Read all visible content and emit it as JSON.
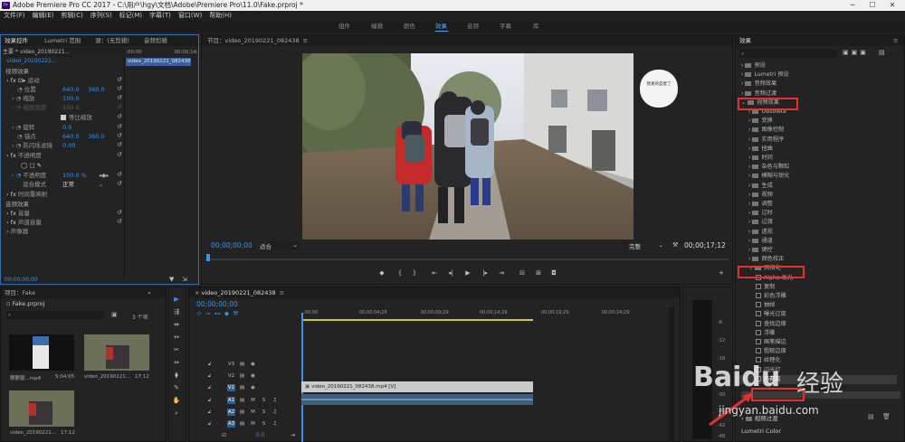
{
  "window": {
    "title": "Adobe Premiere Pro CC 2017 - C:\\用户\\hgy\\文档\\Adobe\\Premiere Pro\\11.0\\Fake.prproj *",
    "app_icon": "Pr",
    "minimize": "─",
    "maximize": "☐",
    "close": "✕"
  },
  "menu": [
    "文件(F)",
    "编辑(E)",
    "剪辑(C)",
    "序列(S)",
    "标记(M)",
    "字幕(T)",
    "窗口(W)",
    "帮助(H)"
  ],
  "workspace_tabs": [
    "组件",
    "编辑",
    "颜色",
    "效果",
    "音频",
    "字幕",
    "库"
  ],
  "workspace_active": "效果",
  "effect_controls": {
    "tabs": [
      "效果控件",
      "Lumetri 范围",
      "源：(无剪辑)",
      "音频剪辑"
    ],
    "master": "主要 * video_20190221...",
    "clip": "video_20190221...",
    "ruler_start": ":00:00",
    "ruler_end": "00:00;14;",
    "clip_bar": "video_20190221_082438.m",
    "video_effects": "视频效果",
    "motion": "运动",
    "position_label": "位置",
    "position_x": "640.0",
    "position_y": "360.0",
    "scale_label": "缩放",
    "scale_val": "100.0",
    "scale_width_label": "缩放宽度",
    "scale_width_val": "100.0",
    "uniform_scale": "等比缩放",
    "rotation_label": "旋转",
    "rotation_val": "0.0",
    "anchor_label": "锚点",
    "anchor_x": "640.0",
    "anchor_y": "360.0",
    "flicker_label": "防闪烁滤镜",
    "flicker_val": "0.00",
    "opacity": "不透明度",
    "opacity_label": "不透明度",
    "opacity_val": "100.0 %",
    "blend_label": "混合模式",
    "blend_val": "正常",
    "time_remap": "时间重映射",
    "audio_effects": "音频效果",
    "volume": "音量",
    "channel_volume": "声道音量",
    "panner": "声像器",
    "timecode": "00;00;00;00"
  },
  "program": {
    "title": "节目：video_20190221_082438",
    "timecode": "00;00;00;00",
    "fit": "适合",
    "quality": "完整",
    "duration": "00;00;17;12",
    "sticker": "我真的是傻了"
  },
  "project": {
    "title": "项目：Fake",
    "file": "Fake.prproj",
    "count": "3 个项",
    "items": [
      {
        "name": "颤颤锯...mp4",
        "dur": "5;04;05"
      },
      {
        "name": "video_20190221...",
        "dur": "17;12"
      },
      {
        "name": "video_20190221...",
        "dur": "17;12"
      }
    ]
  },
  "timeline": {
    "title": "video_20190221_082438",
    "timecode": "00;00;00;00",
    "ruler": [
      ";00;00",
      "00;00;04;29",
      "00;00;09;29",
      "00;00;14;29",
      "00;00;19;29",
      "00;00;24;29"
    ],
    "video_tracks": [
      "V3",
      "V2",
      "V1"
    ],
    "audio_tracks": [
      "A1",
      "A2",
      "A3"
    ],
    "video_clip": "video_20190221_082438.mp4 [V]",
    "master_val": "0.0",
    "meter_ticks": [
      "-6",
      "-12",
      "-18",
      "-24",
      "-30",
      "-36",
      "-42",
      "-48"
    ]
  },
  "effects": {
    "title": "效果",
    "search_placeholder": "",
    "items": [
      {
        "label": "预设",
        "indent": 0,
        "type": "folder"
      },
      {
        "label": "Lumetri 预设",
        "indent": 0,
        "type": "folder"
      },
      {
        "label": "音频效果",
        "indent": 0,
        "type": "folder"
      },
      {
        "label": "音频过渡",
        "indent": 0,
        "type": "folder"
      },
      {
        "label": "视频效果",
        "indent": 0,
        "type": "folder",
        "open": true
      },
      {
        "label": "Obsolete",
        "indent": 1,
        "type": "folder"
      },
      {
        "label": "变换",
        "indent": 1,
        "type": "folder"
      },
      {
        "label": "图像控制",
        "indent": 1,
        "type": "folder"
      },
      {
        "label": "实用程序",
        "indent": 1,
        "type": "folder"
      },
      {
        "label": "扭曲",
        "indent": 1,
        "type": "folder"
      },
      {
        "label": "时间",
        "indent": 1,
        "type": "folder"
      },
      {
        "label": "杂色与颗粒",
        "indent": 1,
        "type": "folder"
      },
      {
        "label": "模糊与锐化",
        "indent": 1,
        "type": "folder"
      },
      {
        "label": "生成",
        "indent": 1,
        "type": "folder"
      },
      {
        "label": "视频",
        "indent": 1,
        "type": "folder"
      },
      {
        "label": "调整",
        "indent": 1,
        "type": "folder"
      },
      {
        "label": "过时",
        "indent": 1,
        "type": "folder"
      },
      {
        "label": "过渡",
        "indent": 1,
        "type": "folder"
      },
      {
        "label": "透视",
        "indent": 1,
        "type": "folder"
      },
      {
        "label": "通道",
        "indent": 1,
        "type": "folder"
      },
      {
        "label": "键控",
        "indent": 1,
        "type": "folder"
      },
      {
        "label": "颜色校正",
        "indent": 1,
        "type": "folder"
      },
      {
        "label": "风格化",
        "indent": 1,
        "type": "folder",
        "open": true
      },
      {
        "label": "Alpha 发光",
        "indent": 2,
        "type": "fx"
      },
      {
        "label": "复制",
        "indent": 2,
        "type": "fx"
      },
      {
        "label": "彩色浮雕",
        "indent": 2,
        "type": "fx"
      },
      {
        "label": "抽帧",
        "indent": 2,
        "type": "fx"
      },
      {
        "label": "曝光过度",
        "indent": 2,
        "type": "fx"
      },
      {
        "label": "查找边缘",
        "indent": 2,
        "type": "fx"
      },
      {
        "label": "浮雕",
        "indent": 2,
        "type": "fx"
      },
      {
        "label": "画笔描边",
        "indent": 2,
        "type": "fx"
      },
      {
        "label": "粗糙边缘",
        "indent": 2,
        "type": "fx"
      },
      {
        "label": "纹理化",
        "indent": 2,
        "type": "fx"
      },
      {
        "label": "闪光灯",
        "indent": 2,
        "type": "fx"
      },
      {
        "label": "马赛克",
        "indent": 2,
        "type": "fx",
        "selected": true
      }
    ],
    "video_transitions": "视频过渡",
    "lumetri_color": "Lumetri Color"
  },
  "watermark": {
    "brand": "Baidu",
    "cn": "经验",
    "url": "jingyan.baidu.com"
  },
  "colors": {
    "accent": "#3d8fe8",
    "highlight": "#e63030",
    "selected_track": "#2d5f8f"
  }
}
